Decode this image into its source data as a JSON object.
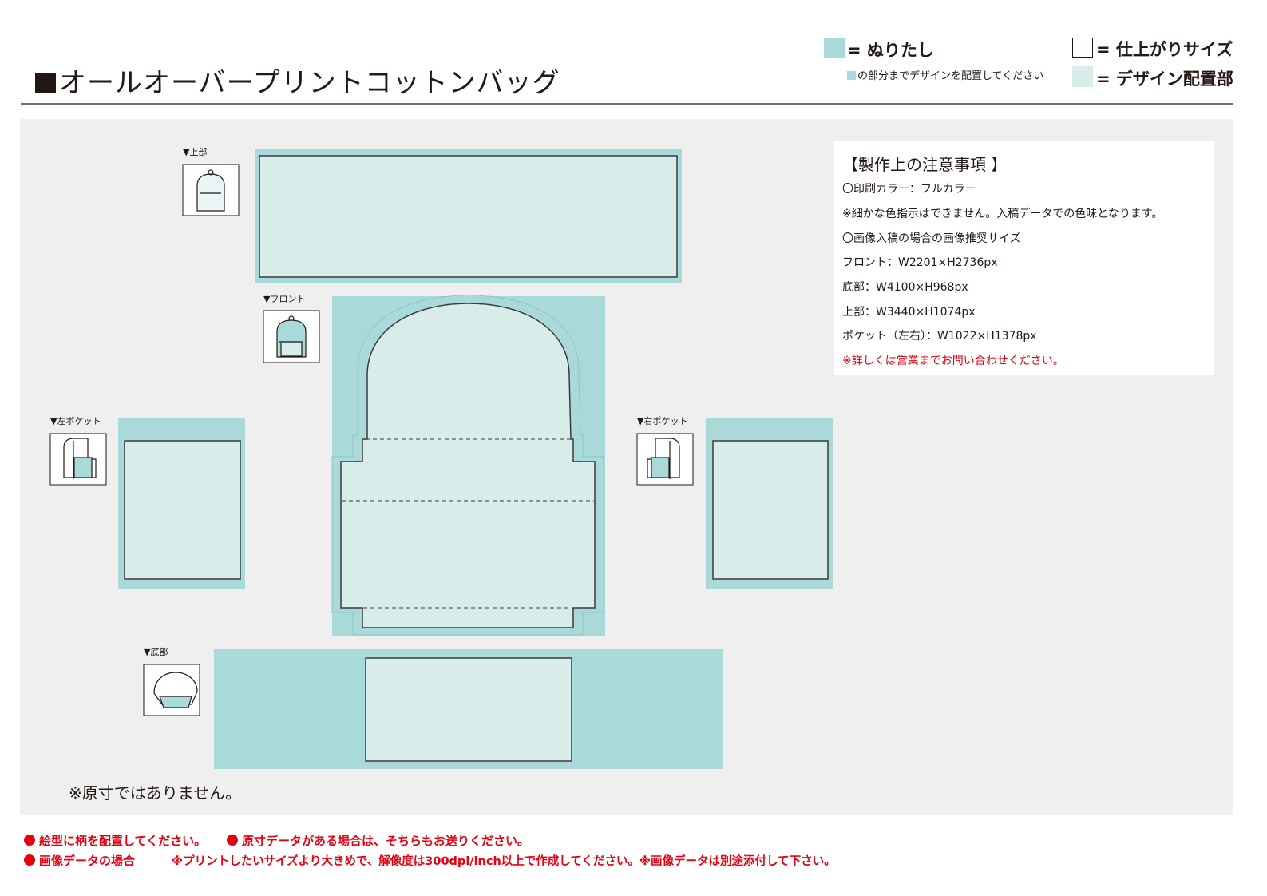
{
  "header": {
    "title": "オールオーバープリントコットンバッグ"
  },
  "legend": {
    "bleed": {
      "label": "= ぬりたし",
      "sub": "の部分までデザインを配置してください",
      "color": "#a9dad9"
    },
    "finish": {
      "label": "= 仕上がりサイズ"
    },
    "design": {
      "label": "= デザイン配置部",
      "color": "#d8ecea"
    }
  },
  "sections": {
    "top": "▼上部",
    "front": "▼フロント",
    "left_pocket": "▼左ポケット",
    "right_pocket": "▼右ポケット",
    "bottom": "▼底部"
  },
  "notes": {
    "title": "【製作上の注意事項 】",
    "lines": [
      "〇印刷カラー：フルカラー",
      "※細かな色指示はできません。入稿データでの色味となります。",
      "〇画像入稿の場合の画像推奨サイズ",
      "フロント：W2201×H2736px",
      "底部：W4100×H968px",
      "上部：W3440×H1074px",
      "ポケット（左右）：W1022×H1378px"
    ],
    "warning": "※詳しくは営業までお問い合わせください。"
  },
  "scale_note": "※原寸ではありません。",
  "footer": {
    "line1a": "絵型に柄を配置してください。",
    "line1b": "原寸データがある場合は、そちらもお送りください。",
    "line2a": "画像データの場合",
    "line2b": "※プリントしたいサイズより大きめで、解像度は300dpi/inch以上で作成してください。※画像データは別途添付して下さい。"
  }
}
